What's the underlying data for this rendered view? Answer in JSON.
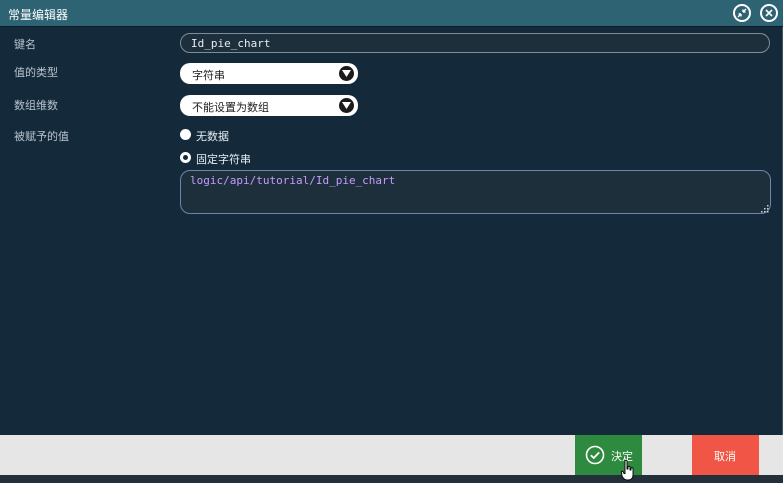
{
  "window": {
    "title": "常量编辑器"
  },
  "fields": {
    "key_label": "键名",
    "key_value": "Id_pie_chart",
    "value_type_label": "值的类型",
    "value_type_selected": "字符串",
    "array_dim_label": "数组维数",
    "array_dim_selected": "不能设置为数组",
    "assigned_value_label": "被赋予的值"
  },
  "radios": [
    {
      "label": "无数据",
      "checked": false
    },
    {
      "label": "固定字符串",
      "checked": true
    }
  ],
  "string_value": "logic/api/tutorial/Id_pie_chart",
  "footer": {
    "ok_label": "決定",
    "cancel_label": "取消"
  },
  "colors": {
    "titlebar": "#2d6373",
    "ok": "#2e8a3e",
    "cancel": "#f05545",
    "text_value": "#c59bff"
  }
}
